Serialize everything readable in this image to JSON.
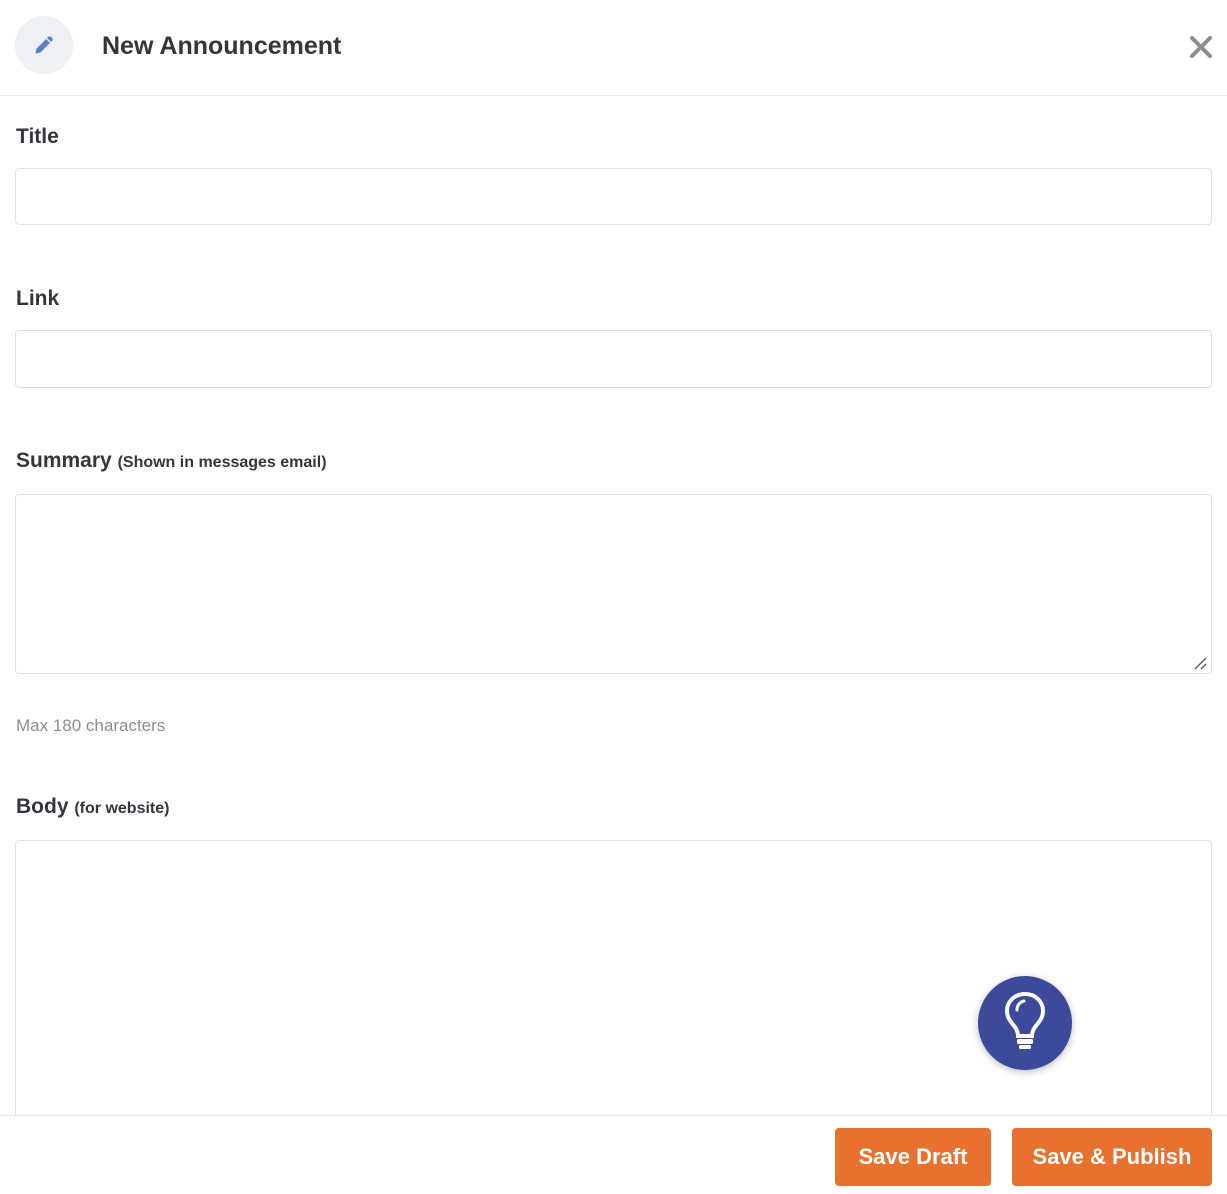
{
  "header": {
    "title": "New Announcement",
    "icon": "pencil-icon",
    "close_icon": "close-icon"
  },
  "form": {
    "title": {
      "label": "Title",
      "value": ""
    },
    "link": {
      "label": "Link",
      "value": ""
    },
    "summary": {
      "label": "Summary",
      "sublabel": "(Shown in messages email)",
      "value": "",
      "hint": "Max 180 characters"
    },
    "body": {
      "label": "Body",
      "sublabel": "(for website)",
      "value": ""
    }
  },
  "help_fab": {
    "icon": "lightbulb-icon"
  },
  "footer": {
    "save_draft_label": "Save Draft",
    "save_publish_label": "Save & Publish"
  },
  "colors": {
    "accent": "#e8712f",
    "fab": "#3c4a99",
    "pencil": "#5b7fc4"
  }
}
